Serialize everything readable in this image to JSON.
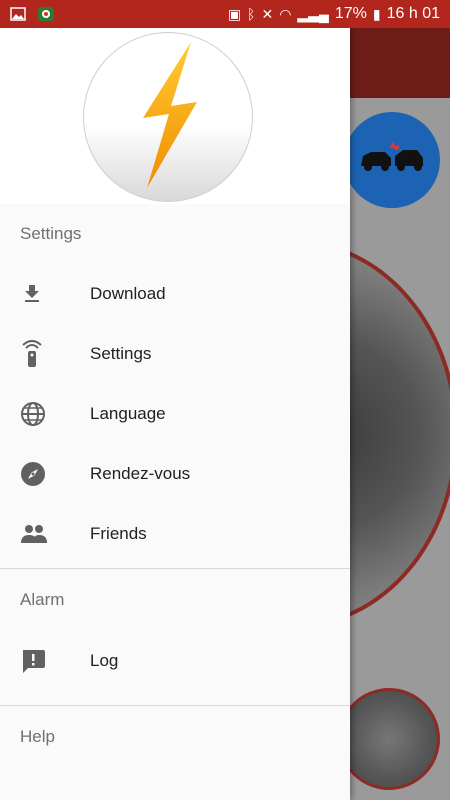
{
  "status_bar": {
    "battery": "17%",
    "time": "16 h 01"
  },
  "drawer": {
    "sections": [
      {
        "title": "Settings",
        "items": [
          {
            "label": "Download",
            "icon": "download-icon"
          },
          {
            "label": "Settings",
            "icon": "remote-icon"
          },
          {
            "label": "Language",
            "icon": "globe-icon"
          },
          {
            "label": "Rendez-vous",
            "icon": "compass-icon"
          },
          {
            "label": "Friends",
            "icon": "people-icon"
          }
        ]
      },
      {
        "title": "Alarm",
        "items": [
          {
            "label": "Log",
            "icon": "feedback-icon"
          }
        ]
      },
      {
        "title": "Help",
        "items": []
      }
    ]
  },
  "colors": {
    "status_bar": "#b3261e",
    "logo_bolt": "#f5a623",
    "accident_button": "#1d63b4"
  }
}
